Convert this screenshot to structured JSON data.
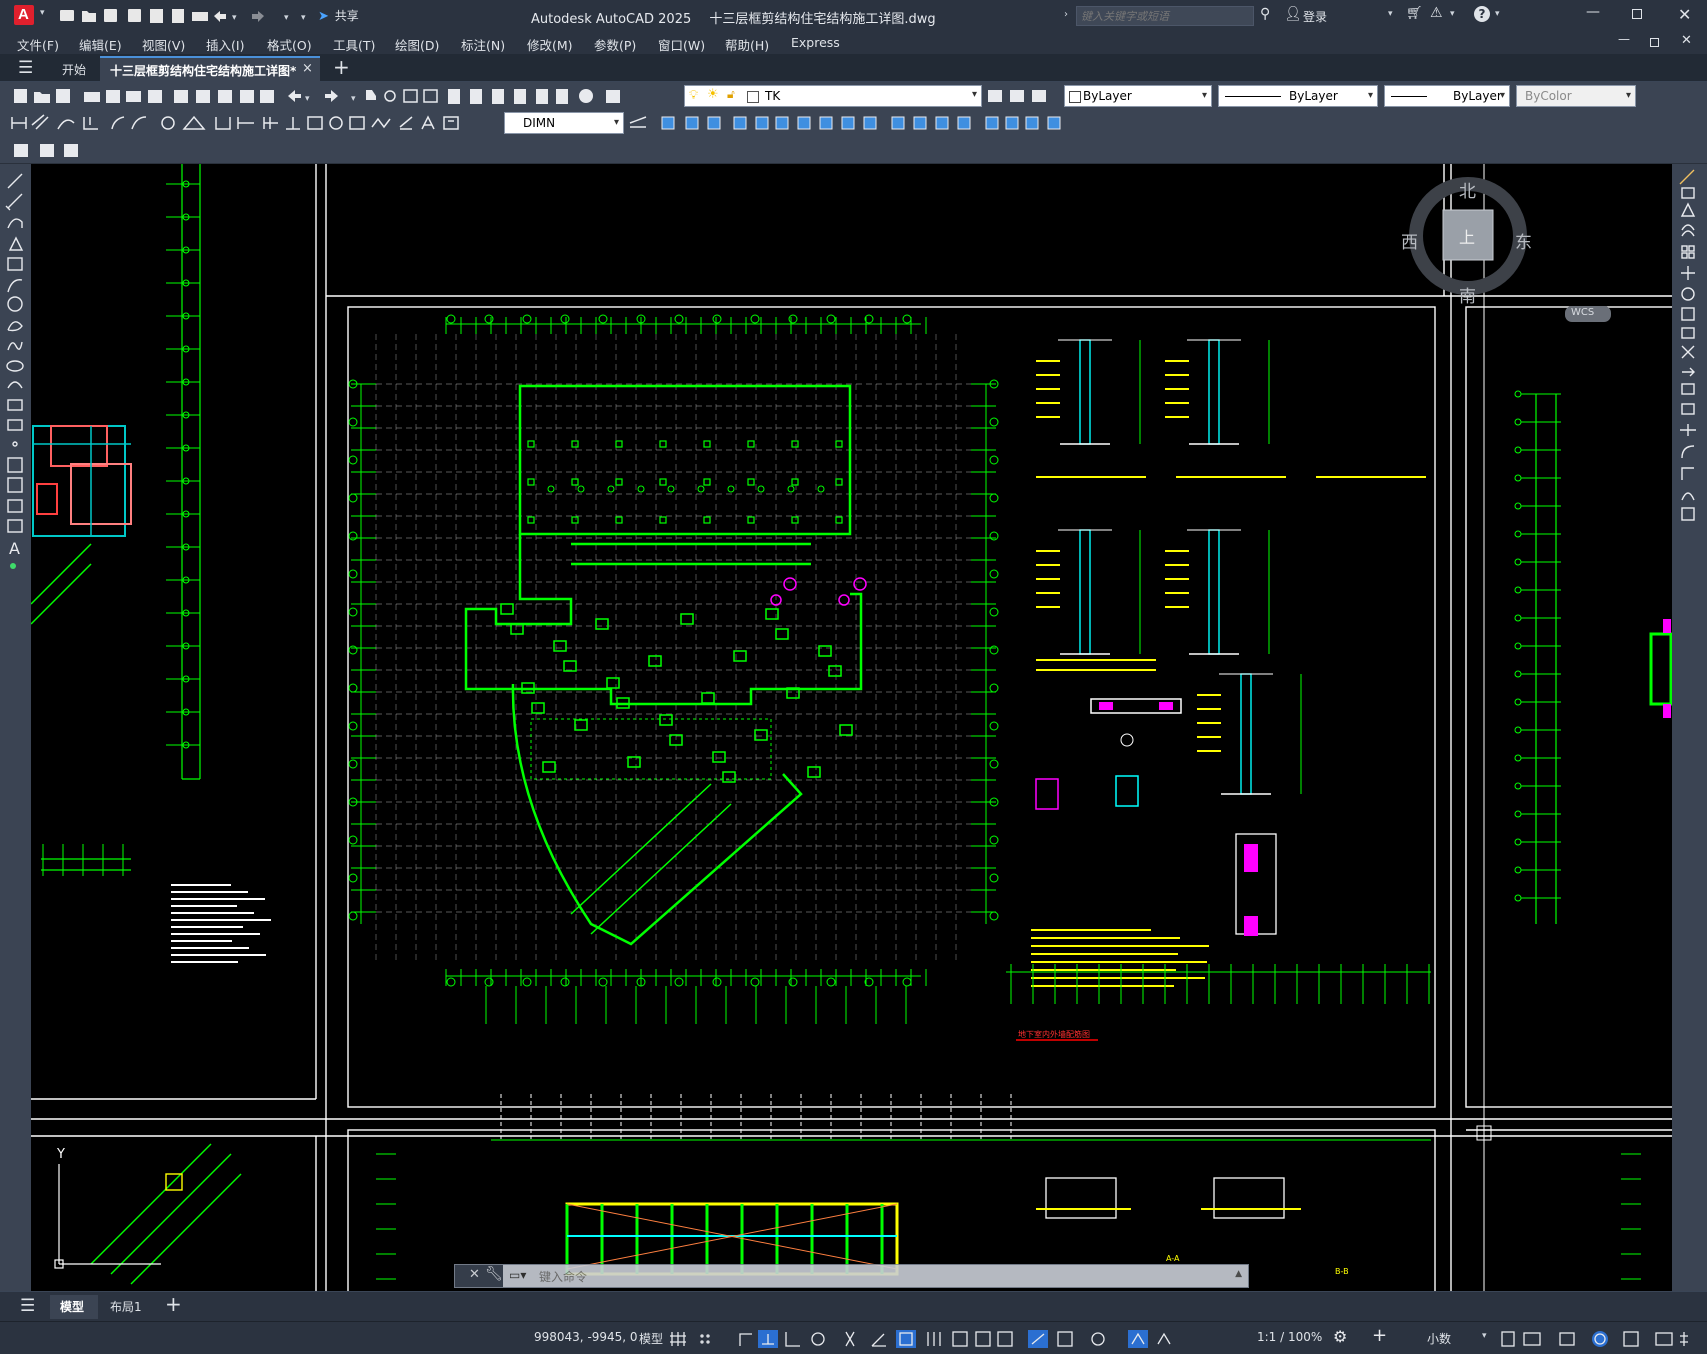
{
  "window": {
    "app_title": "Autodesk AutoCAD 2025",
    "doc_title": "十三层框剪结构住宅结构施工详图.dwg",
    "app_letter": "A",
    "share_label": "共享",
    "search_placeholder": "键入关键字或短语",
    "login_label": "登录"
  },
  "menu": [
    {
      "label": "文件(F)"
    },
    {
      "label": "编辑(E)"
    },
    {
      "label": "视图(V)"
    },
    {
      "label": "插入(I)"
    },
    {
      "label": "格式(O)"
    },
    {
      "label": "工具(T)"
    },
    {
      "label": "绘图(D)"
    },
    {
      "label": "标注(N)"
    },
    {
      "label": "修改(M)"
    },
    {
      "label": "参数(P)"
    },
    {
      "label": "窗口(W)"
    },
    {
      "label": "帮助(H)"
    },
    {
      "label": "Express"
    }
  ],
  "tabs": {
    "start": "开始",
    "active": "十三层框剪结构住宅结构施工详图*",
    "close": "×",
    "add": "+"
  },
  "toolbar": {
    "layer_name": "TK",
    "color": "ByLayer",
    "linetype": "ByLayer",
    "lineweight": "ByLayer",
    "plotstyle": "ByColor",
    "dimstyle": "DIMN"
  },
  "viewcube": {
    "north": "北",
    "south": "南",
    "east": "东",
    "west": "西",
    "face": "上",
    "wcs": "WCS"
  },
  "command": {
    "placeholder": "键入命令"
  },
  "drawing": {
    "red_note": "地下室内外墙配筋图",
    "section_labels": [
      "A-A",
      "B-B"
    ],
    "ucs_y": "Y"
  },
  "layout_tabs": {
    "model": "模型",
    "layout1": "布局1",
    "add": "+"
  },
  "status": {
    "coords": "998043, -9945, 0",
    "model": "模型",
    "scale": "1:1 / 100%",
    "units": "小数"
  },
  "colors": {
    "chrome": "#2b3340",
    "toolbar": "#3b4453",
    "canvas": "#000000",
    "cad_green": "#00ff00",
    "cad_white": "#ffffff",
    "cad_yellow": "#ffff00",
    "cad_cyan": "#00ffff",
    "cad_magenta": "#ff00ff",
    "cad_red": "#ff0000"
  }
}
